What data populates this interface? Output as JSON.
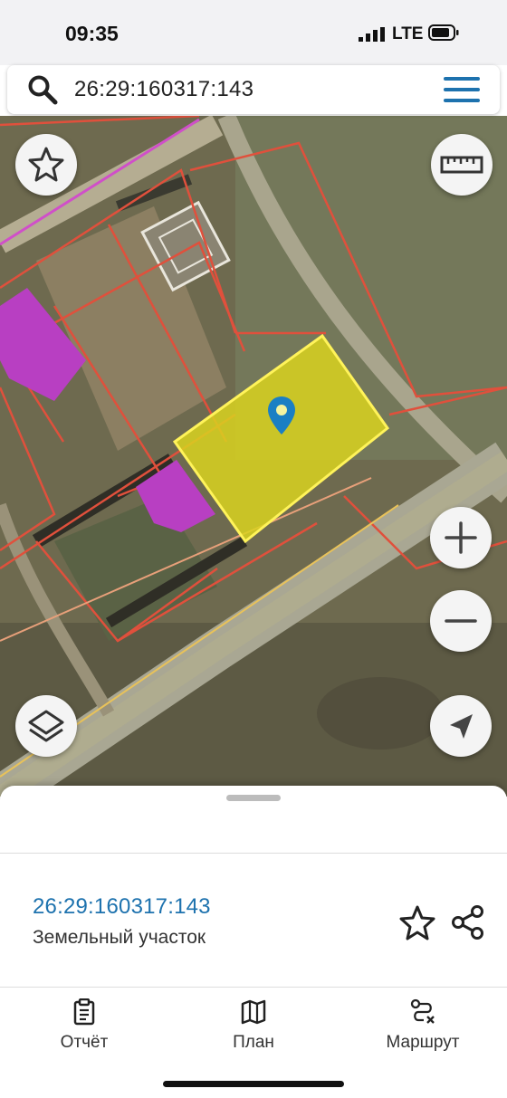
{
  "status_bar": {
    "time": "09:35",
    "network": "LTE"
  },
  "search": {
    "query": "26:29:160317:143",
    "icon": "search-icon",
    "menu_icon": "hamburger-menu-icon"
  },
  "map": {
    "controls": {
      "favorite": "star-icon",
      "ruler": "ruler-icon",
      "zoom_in": "plus-icon",
      "zoom_out": "minus-icon",
      "layers": "layers-icon",
      "locate": "navigation-arrow-icon"
    },
    "colors": {
      "selected_parcel": "#d9d21e",
      "parcel_border": "#e0503c",
      "building": "#b83fc2",
      "pin": "#1a7fc4"
    }
  },
  "parcel_card": {
    "cadastral_number": "26:29:160317:143",
    "type": "Земельный участок",
    "favorite_icon": "star-outline-icon",
    "share_icon": "share-icon"
  },
  "tabs": [
    {
      "label": "Отчёт",
      "icon": "report-clipboard-icon"
    },
    {
      "label": "План",
      "icon": "map-plan-icon"
    },
    {
      "label": "Маршрут",
      "icon": "route-icon"
    }
  ]
}
